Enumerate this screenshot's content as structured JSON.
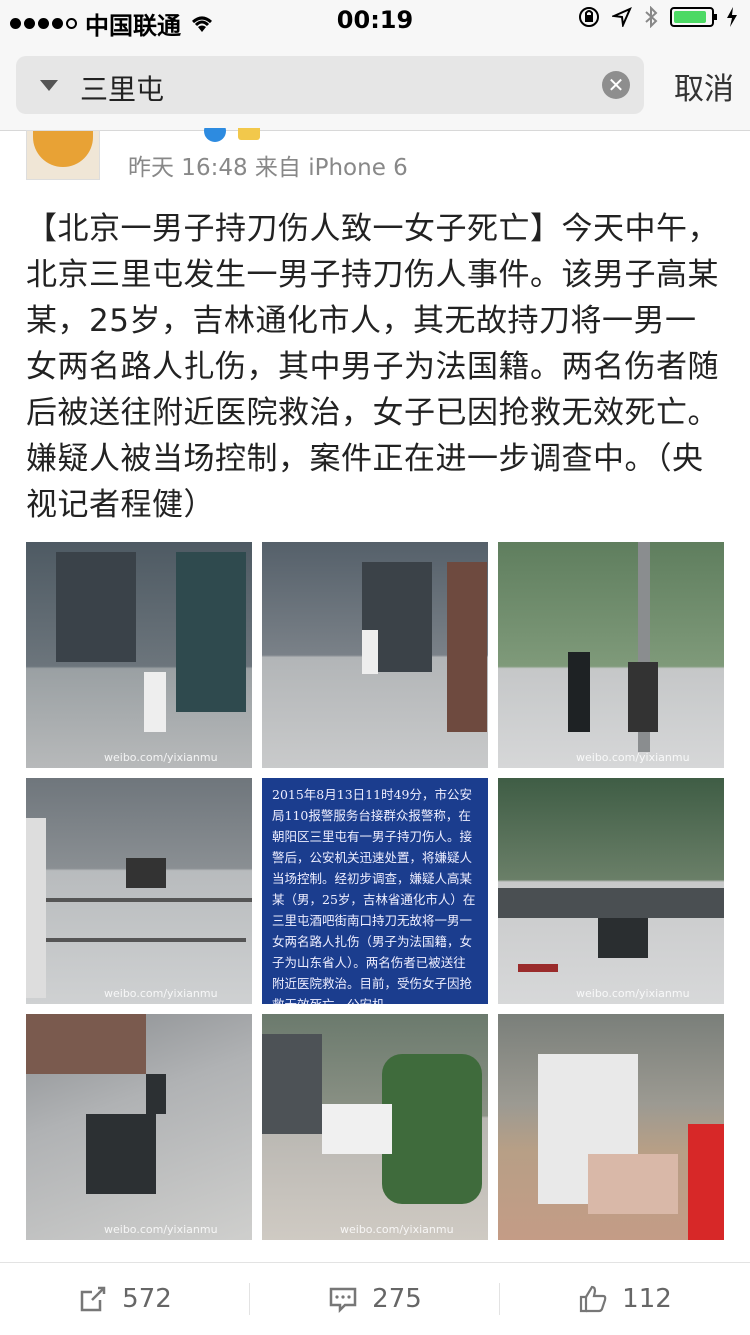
{
  "status_bar": {
    "carrier": "中国联通",
    "time": "00:19"
  },
  "search": {
    "query": "三里屯",
    "cancel_label": "取消"
  },
  "post": {
    "meta": "昨天 16:48  来自 iPhone 6",
    "text": "【北京一男子持刀伤人致一女子死亡】今天中午，北京三里屯发生一男子持刀伤人事件。该男子高某某，25岁，吉林通化市人，其无故持刀将一男一女两名路人扎伤，其中男子为法国籍。两名伤者随后被送往附近医院救治，女子已因抢救无效死亡。嫌疑人被当场控制，案件正在进一步调查中。（央视记者程健）",
    "images": [
      {
        "watermark": "weibo.com/yixianmu"
      },
      {
        "watermark": ""
      },
      {
        "watermark": "weibo.com/yixianmu"
      },
      {
        "watermark": "weibo.com/yixianmu"
      },
      {
        "watermark": ""
      },
      {
        "watermark": "weibo.com/yixianmu"
      },
      {
        "watermark": "weibo.com/yixianmu"
      },
      {
        "watermark": "weibo.com/yixianmu"
      },
      {
        "watermark": ""
      }
    ],
    "news_image_text": "2015年8月13日11时49分，市公安局110报警服务台接群众报警称，在朝阳区三里屯有一男子持刀伤人。接警后，公安机关迅速处置，将嫌疑人当场控制。经初步调查，嫌疑人高某某（男，25岁，吉林省通化市人）在三里屯酒吧街南口持刀无故将一男一女两名路人扎伤（男子为法国籍，女子为山东省人）。两名伤者已被送往附近医院救治。目前，受伤女子因抢救无效死亡。公安机"
  },
  "actions": {
    "repost_count": "572",
    "comment_count": "275",
    "like_count": "112"
  }
}
